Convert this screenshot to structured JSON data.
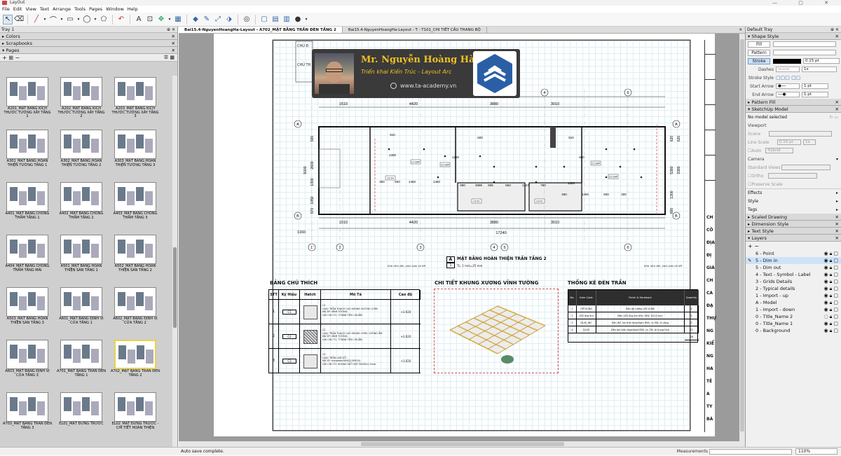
{
  "window": {
    "title": "LayOut",
    "controls": "—  ▢  ✕"
  },
  "menu": [
    "File",
    "Edit",
    "View",
    "Text",
    "Arrange",
    "Tools",
    "Pages",
    "Window",
    "Help"
  ],
  "left": {
    "tray_title": "Tray 1",
    "sections": [
      "Colors",
      "Scrapbooks",
      "Pages"
    ],
    "pages_toolbar": "+  ⊞  −",
    "pages": [
      "A201_MẶT BẰNG KÍCH THƯỚC TƯỜNG XÂY TẦNG 1",
      "A202_MẶT BẰNG KÍCH THƯỚC TƯỜNG XÂY TẦNG 2",
      "A203_MẶT BẰNG KÍCH THƯỚC TƯỜNG XÂY TẦNG 3",
      "A301_MẶT BẰNG HOÀN THIỆN TƯỜNG TẦNG 1",
      "A302_MẶT BẰNG HOÀN THIỆN TƯỜNG TẦNG 2",
      "A303_MẶT BẰNG HOÀN THIỆN TƯỜNG TẦNG 3",
      "A401_MẶT BẰNG CHỐNG THẤM TẦNG 1",
      "A402_MẶT BẰNG CHỐNG THẤM TẦNG 2",
      "A403_MẶT BẰNG CHỐNG THẤM TẦNG 3",
      "A404_MẶT BẰNG CHỐNG THẤM TẦNG MÁI",
      "A501_MẶT BẰNG HOÀN THIỆN SÀN TẦNG 1",
      "A502_MẶT BẰNG HOÀN THIỆN SÀN TẦNG 2",
      "A503_MẶT BẰNG HOÀN THIỆN SÀN TẦNG 3",
      "A601_MẶT BẰNG ĐỊNH VỊ CỬA TẦNG 1",
      "A602_MẶT BẰNG ĐỊNH VỊ CỬA TẦNG 2",
      "A603_MẶT BẰNG ĐỊNH VỊ CỬA TẦNG 3",
      "A701_MẶT BẰNG TRẦN ĐÈN TẦNG 1",
      "A702_MẶT BẰNG TRẦN ĐÈN TẦNG 2",
      "A703_MẶT BẰNG TRẦN ĐÈN TẦNG 3",
      "EL01_MẶT ĐỨNG TRƯỚC",
      "EL02_MẶT ĐỨNG TRƯỚC - CHI TIẾT HOÀN THIỆN"
    ]
  },
  "tabs": [
    "Bai15.4-NguyenHoangHa-Layout - A702_MẶT BẰNG TRẦN ĐÈN TẦNG 2",
    "Bai15.4-NguyenHoangHa-Layout - T - T101_CHI TIẾT CẦU THANG BỘ"
  ],
  "tabs_close": "✕",
  "drawing": {
    "banner_name": "Mr. Nguyễn Hoàng Hà",
    "banner_sub": "Triển khai Kiến Trúc - Layout Arc",
    "banner_web": "www.ta-academy.vn",
    "header_chu": "CHỦ Đ",
    "header_chu2": "CHỦ TH",
    "dims_top": [
      "1510",
      "4420",
      "3880",
      "3010"
    ],
    "dim_860": "860",
    "dims_bottom": [
      "1510",
      "4420",
      "3880",
      "3010"
    ],
    "dim_total": "17240",
    "dim_total_top": "17240",
    "dim_1160": "1160",
    "axes_top": [
      "1",
      "2",
      "3",
      "4",
      "5",
      "6"
    ],
    "axes_bottom": [
      "1'",
      "2",
      "3",
      "4",
      "5",
      "6"
    ],
    "axes_side": [
      "A",
      "B"
    ],
    "left_dims": [
      "5000",
      "2600",
      "1300",
      "1050",
      "970",
      "920"
    ],
    "right_dims": [
      "3380",
      "5380",
      "620",
      "1300",
      "800",
      "620"
    ],
    "inner_dims": [
      "300",
      "600",
      "1460",
      "1460",
      "480",
      "2695",
      "505",
      "663",
      "1347",
      "760",
      "460",
      "1460",
      "600",
      "300",
      "910",
      "1300",
      "1280",
      "600",
      "910",
      "600",
      "1380"
    ],
    "room_tags": [
      "C2 CH",
      "C1 GAP",
      "C2 GAP",
      "C3 VC",
      "C3 VC",
      "C1 GAP",
      "C2 GAP"
    ],
    "note_left": "Khe rèm đôi, xem bản vẽ KR",
    "note_right": "Khe rèm đôi, xem bản vẽ KR",
    "plan_label_letter": "A",
    "plan_title": "MẶT BẰNG HOÀN THIỆN TRẦN TẦNG 2",
    "plan_scale": "TL: 1 mm=25 mm",
    "plan_scale_num": "1",
    "legend_title": "BẢNG CHÚ THÍCH",
    "legend_headers": [
      "STT",
      "Ký Hiệu",
      "Hatch",
      "Mô Tả",
      "Cao độ"
    ],
    "legend_rows": [
      {
        "stt": "1",
        "sym": "C1",
        "desc": "C1\nLOẠI: TRẦN THẠCH CAO KHUNG XƯƠNG CHÌM.\nMÃ SP: VĨNH TƯỜNG.\nGHI CHÚ TC: T.TKĐĐ TIÊU CHUẨN.",
        "h": "+3.020"
      },
      {
        "stt": "2",
        "sym": "C2",
        "desc": "C2\nLOẠI: TRẦN THẠCH CAO KHUNG CHÌM, CHỐNG ẨM.\nMÃ SP: VĨNH TƯỜNG.\nGHI CHÚ TC: T.TKĐĐ TIÊU CHUẨN.",
        "h": "+3.020"
      },
      {
        "stt": "3",
        "sym": "C3",
        "desc": "C3\nLOẠI: TRẦN LAM GỖ.\nMÃ SP: Iconwood KING2(39X20).\nGHI CHÚ TC: KHUNG SẮT HỘP 30x30x1.2mm.",
        "h": "+3.020"
      }
    ],
    "detail_title": "CHI TIẾT KHUNG XƯƠNG VĨNH TƯỜNG",
    "stats_title": "THỐNG KÊ ĐÈN TRẦN",
    "stats_headers": [
      "No.",
      "Item Code",
      "Finish & Hardware",
      "Quantity"
    ],
    "stats_rows": [
      [
        "1",
        "OPTUONG",
        "Đèn ốp tường LED 6-8W",
        "3"
      ],
      [
        "2",
        "LED ống âm",
        "Đèn LED ống âm trần 10W, D110 mm",
        "3"
      ],
      [
        "3",
        "DL90_WC",
        "Đèn WC âm trần downlight Ø90, cs 9W, Al vàng",
        "3"
      ],
      [
        "4",
        "DL90",
        "Đèn âm trần downlight Ø90, cs 7W, Al trung tính",
        "20"
      ]
    ],
    "stats_total": "26",
    "right_strip": [
      "CH",
      "CÔ",
      "ĐỊA",
      "ĐỊ",
      "GIÁ",
      "CH",
      "CA",
      "ĐẠ",
      "THỰ",
      "NG",
      "KIỂ",
      "NG",
      "HA",
      "TÊ",
      "A",
      "TY",
      "BÁ"
    ]
  },
  "right": {
    "tray_title": "Default Tray",
    "shape_style": "Shape Style",
    "fill": "Fill",
    "pattern": "Pattern",
    "stroke": "Stroke",
    "stroke_width": "0.15 pt",
    "dashes": "Dashes",
    "dash_scale": "1x",
    "stroke_style": "Stroke Style",
    "start_arrow": "Start Arrow",
    "end_arrow": "End Arrow",
    "arrow_size": "1 pt",
    "pattern_fill": "Pattern Fill",
    "sketchup_model": "SketchUp Model",
    "no_model": "No model selected",
    "viewport": "Viewport",
    "scene": "Scene",
    "line_scale": "Line Scale",
    "line_scale_val": "0.10 pt",
    "line_scale_x": "1x",
    "auto": "Auto",
    "hybrid": "Hybrid",
    "camera": "Camera",
    "standard_views": "Standard Views",
    "ortho": "Ortho",
    "preserve_scale": "Preserve Scale",
    "effects": "Effects",
    "style": "Style",
    "tags": "Tags",
    "scaled_drawing": "Scaled Drawing",
    "dimension_style": "Dimension Style",
    "text_style": "Text Style",
    "layers": "Layers",
    "layers_tb": "+  −",
    "layer_list": [
      "6 - Point",
      "5 - Dim in",
      "5 - Dim out",
      "4 - Text - Symbol - Label",
      "3 - Grids Details",
      "2 - Typical details",
      "1 - Import - up",
      "A - Model",
      "1 - Import - down",
      "0 - Title_Name 2",
      "0 - Title_Name 1",
      "0 - Background"
    ]
  },
  "status": {
    "msg": "Auto save complete.",
    "measurements": "Measurements",
    "zoom": "110%"
  },
  "colors": {
    "accent": "#3b6ea8",
    "selected_page": "#e8d24a",
    "banner_bg": "#3a3a3a",
    "banner_name": "#f0c020"
  }
}
